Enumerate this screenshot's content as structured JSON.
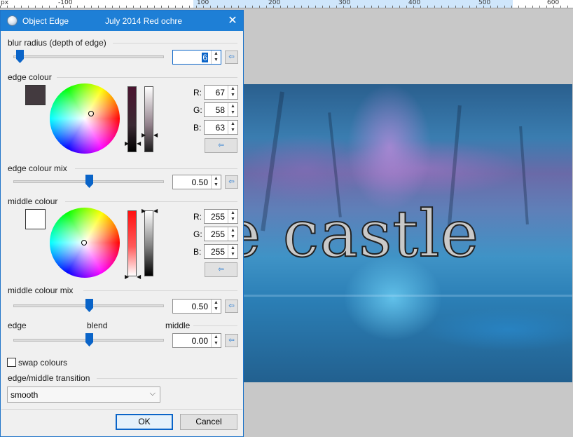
{
  "ruler": {
    "unit": "px",
    "labels": [
      "-100",
      "100",
      "200",
      "300",
      "400",
      "500",
      "600"
    ]
  },
  "canvas": {
    "text": "e castle"
  },
  "dialog": {
    "title": "Object Edge",
    "subtitle": "July 2014  Red ochre",
    "close_glyph": "✕",
    "blur_radius": {
      "label": "blur radius (depth of edge)",
      "value": "6",
      "slider_fraction": 0.04
    },
    "edge_colour": {
      "label": "edge colour",
      "swatch": "#433a3f",
      "r_label": "R:",
      "g_label": "G:",
      "b_label": "B:",
      "r": "67",
      "g": "58",
      "b": "63"
    },
    "edge_colour_mix": {
      "label": "edge colour mix",
      "value": "0.50",
      "slider_fraction": 0.5
    },
    "middle_colour": {
      "label": "middle colour",
      "swatch": "#ffffff",
      "r_label": "R:",
      "g_label": "G:",
      "b_label": "B:",
      "r": "255",
      "g": "255",
      "b": "255"
    },
    "middle_colour_mix": {
      "label": "middle colour mix",
      "value": "0.50",
      "slider_fraction": 0.5
    },
    "blend": {
      "left_label": "edge",
      "center_label": "blend",
      "right_label": "middle",
      "value": "0.00",
      "slider_fraction": 0.5
    },
    "swap_colours": {
      "label": "swap colours",
      "checked": false
    },
    "transition": {
      "label": "edge/middle transition",
      "selected": "smooth"
    },
    "ok_label": "OK",
    "cancel_label": "Cancel",
    "reset_glyph": "⇦"
  }
}
